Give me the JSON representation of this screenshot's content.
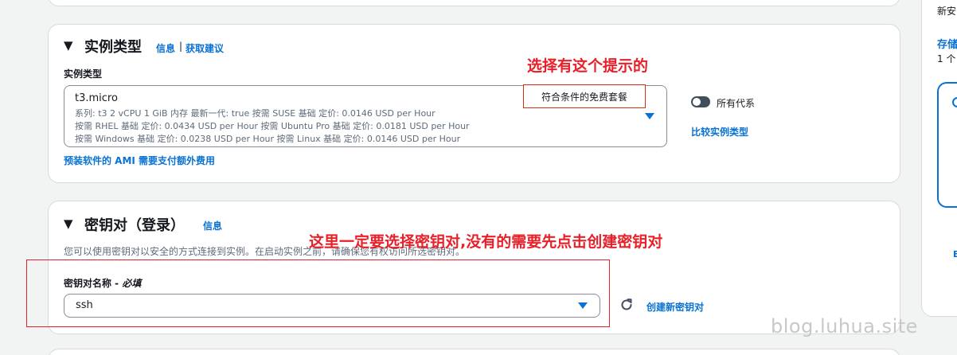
{
  "instance_section": {
    "title": "实例类型",
    "info_link": "信息",
    "separator": "|",
    "recommend_link": "获取建议",
    "field_label": "实例类型",
    "selected": {
      "name": "t3.micro",
      "line1": "系列: t3    2 vCPU    1 GiB 内存    最新一代: true         按需 SUSE 基础 定价: 0.0146 USD per Hour",
      "line2": "按需 RHEL 基础 定价: 0.0434 USD per Hour    按需 Ubuntu Pro 基础 定价: 0.0181 USD per Hour",
      "line3": "按需 Windows 基础 定价: 0.0238 USD per Hour    按需 Linux 基础 定价: 0.0146 USD per Hour",
      "badge": "符合条件的免费套餐"
    },
    "toggle_label": "所有代系",
    "compare_link": "比较实例类型",
    "ami_link": "预装软件的 AMI 需要支付额外费用"
  },
  "key_section": {
    "title": "密钥对（登录）",
    "info_link": "信息",
    "description": "您可以使用密钥对以安全的方式连接到实例。在启动实例之前，请确保您有权访问所选密钥对。",
    "field_label": "密钥对名称",
    "required_suffix": " - 必填",
    "selected_value": "ssh",
    "create_link": "创建新密钥对"
  },
  "annotations": {
    "instance_note": "选择有这个提示的",
    "key_note": "这里一定要选择密钥对,没有的需要先点击创建密钥对"
  },
  "side_panel": {
    "top_text": "新安",
    "storage_label": "存储",
    "count_text": "1 个",
    "bottom_letter": "E"
  },
  "watermark": "blog.luhua.site",
  "colors": {
    "link": "#0972d3",
    "annotation": "#e8202a",
    "border": "#8c8c94"
  }
}
